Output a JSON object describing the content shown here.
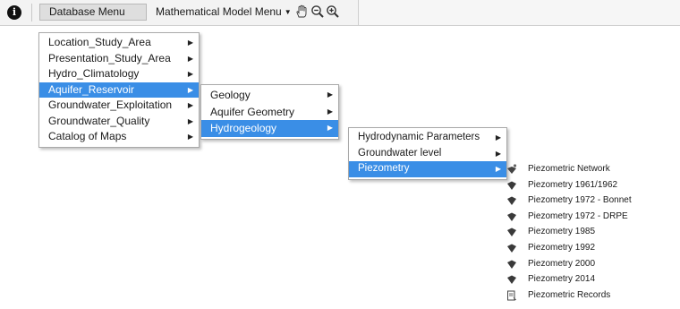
{
  "toolbar": {
    "info_icon": "info-icon",
    "database_menu": "Database Menu",
    "math_menu": "Mathematical Model Menu",
    "tools": [
      "pan-hand-icon",
      "zoom-out-icon",
      "zoom-in-icon"
    ]
  },
  "database_menu": {
    "items": [
      {
        "label": "Location_Study_Area",
        "has_submenu": true
      },
      {
        "label": "Presentation_Study_Area",
        "has_submenu": true
      },
      {
        "label": "Hydro_Climatology",
        "has_submenu": true
      },
      {
        "label": "Aquifer_Reservoir",
        "has_submenu": true,
        "selected": true
      },
      {
        "label": "Groundwater_Exploitation",
        "has_submenu": true
      },
      {
        "label": "Groundwater_Quality",
        "has_submenu": true
      },
      {
        "label": "Catalog of Maps",
        "has_submenu": true
      }
    ]
  },
  "aquifer_menu": {
    "items": [
      {
        "label": "Geology",
        "has_submenu": true
      },
      {
        "label": "Aquifer Geometry",
        "has_submenu": true
      },
      {
        "label": "Hydrogeology",
        "has_submenu": true,
        "selected": true
      }
    ]
  },
  "hydrogeology_menu": {
    "items": [
      {
        "label": "Hydrodynamic Parameters",
        "has_submenu": true
      },
      {
        "label": "Groundwater level",
        "has_submenu": true
      },
      {
        "label": "Piezometry",
        "has_submenu": true,
        "selected": true
      }
    ]
  },
  "piezometry_menu": {
    "items": [
      {
        "label": "Piezometric Network",
        "icon": "network-icon"
      },
      {
        "label": "Piezometry 1961/1962",
        "icon": "layer-icon"
      },
      {
        "label": "Piezometry 1972 - Bonnet",
        "icon": "layer-icon"
      },
      {
        "label": "Piezometry 1972 - DRPE",
        "icon": "layer-icon"
      },
      {
        "label": "Piezometry 1985",
        "icon": "layer-icon"
      },
      {
        "label": "Piezometry 1992",
        "icon": "layer-icon"
      },
      {
        "label": "Piezometry 2000",
        "icon": "layer-icon"
      },
      {
        "label": "Piezometry 2014",
        "icon": "layer-icon"
      },
      {
        "label": "Piezometric Records",
        "icon": "records-icon"
      }
    ]
  },
  "colors": {
    "selection": "#3a8ee6",
    "toolbar_bg": "#f6f6f6",
    "menu_border": "#a9a9a9"
  }
}
